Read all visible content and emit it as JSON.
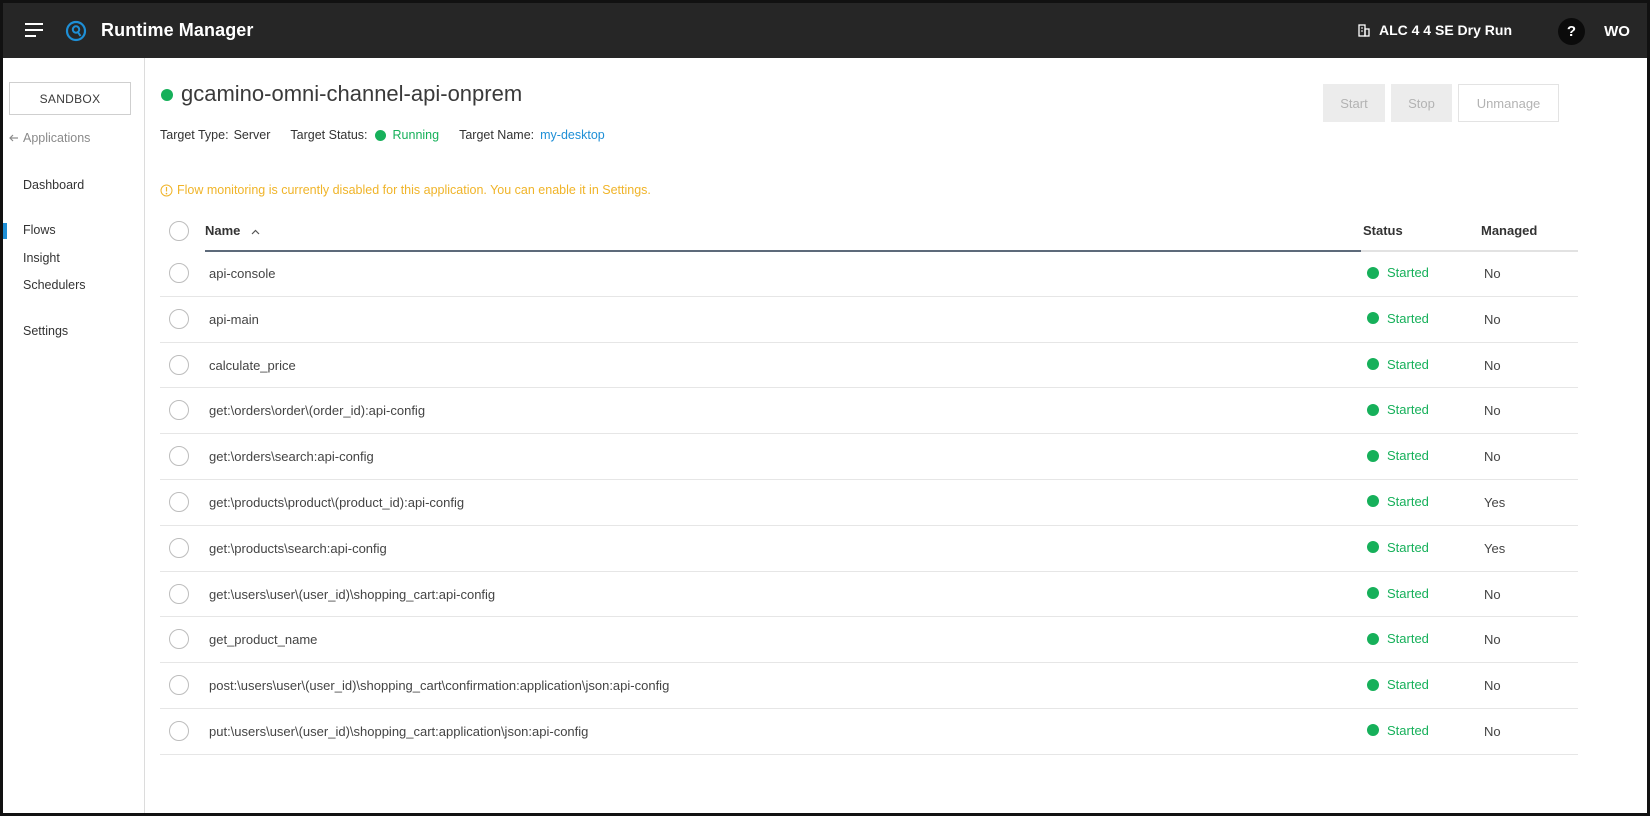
{
  "header": {
    "app_title": "Runtime Manager",
    "org_name": "ALC 4 4 SE Dry Run",
    "help_label": "?",
    "user_initials": "WO"
  },
  "sidebar": {
    "environment": "SANDBOX",
    "back_label": "Applications",
    "items": [
      {
        "label": "Dashboard",
        "active": false
      },
      {
        "label": "Flows",
        "active": true
      },
      {
        "label": "Insight",
        "active": false
      },
      {
        "label": "Schedulers",
        "active": false
      },
      {
        "label": "Settings",
        "active": false
      }
    ]
  },
  "app": {
    "name": "gcamino-omni-channel-api-onprem",
    "target_type_label": "Target Type:",
    "target_type": "Server",
    "target_status_label": "Target Status:",
    "target_status": "Running",
    "target_name_label": "Target Name:",
    "target_name": "my-desktop"
  },
  "actions": {
    "start": "Start",
    "stop": "Stop",
    "unmanage": "Unmanage"
  },
  "warning": "Flow monitoring is currently disabled for this application. You can enable it in Settings.",
  "table": {
    "headers": {
      "name": "Name",
      "status": "Status",
      "managed": "Managed"
    },
    "rows": [
      {
        "name": "api-console",
        "status": "Started",
        "managed": "No"
      },
      {
        "name": "api-main",
        "status": "Started",
        "managed": "No"
      },
      {
        "name": "calculate_price",
        "status": "Started",
        "managed": "No"
      },
      {
        "name": "get:\\orders\\order\\(order_id):api-config",
        "status": "Started",
        "managed": "No"
      },
      {
        "name": "get:\\orders\\search:api-config",
        "status": "Started",
        "managed": "No"
      },
      {
        "name": "get:\\products\\product\\(product_id):api-config",
        "status": "Started",
        "managed": "Yes"
      },
      {
        "name": "get:\\products\\search:api-config",
        "status": "Started",
        "managed": "Yes"
      },
      {
        "name": "get:\\users\\user\\(user_id)\\shopping_cart:api-config",
        "status": "Started",
        "managed": "No"
      },
      {
        "name": "get_product_name",
        "status": "Started",
        "managed": "No"
      },
      {
        "name": "post:\\users\\user\\(user_id)\\shopping_cart\\confirmation:application\\json:api-config",
        "status": "Started",
        "managed": "No"
      },
      {
        "name": "put:\\users\\user\\(user_id)\\shopping_cart:application\\json:api-config",
        "status": "Started",
        "managed": "No"
      }
    ]
  },
  "colors": {
    "topbar": "#262626",
    "success": "#16b05a",
    "link": "#1e8fd6",
    "warning": "#f0b429"
  }
}
